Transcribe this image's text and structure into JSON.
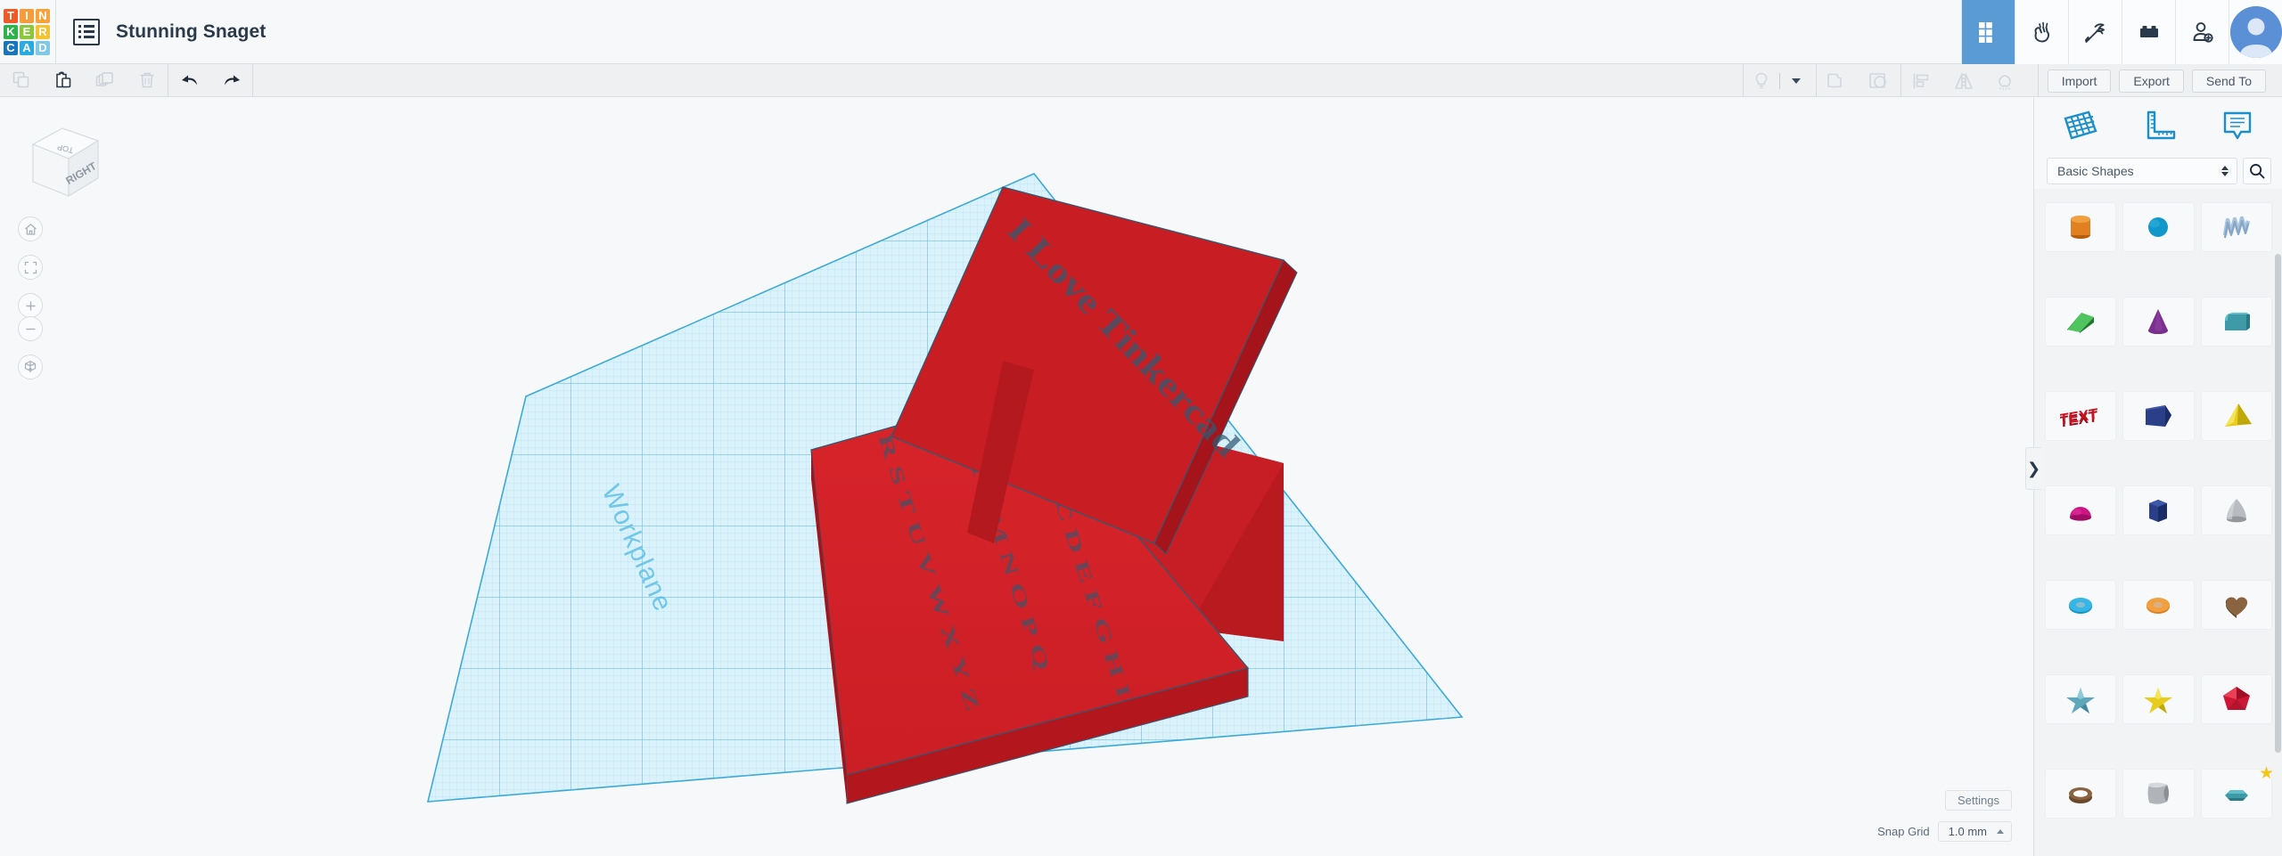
{
  "header": {
    "logo_text": [
      "T",
      "I",
      "N",
      "K",
      "E",
      "R",
      "C",
      "A",
      "D"
    ],
    "logo_colors": [
      "#f05a28",
      "#f79c3c",
      "#f7a23c",
      "#2eb24a",
      "#8cc63f",
      "#f2c230",
      "#1b75bb",
      "#29abe2",
      "#7fc8e8"
    ],
    "menu_icon": "list-menu-icon",
    "doc_title": "Stunning Snaget",
    "right_buttons": [
      {
        "name": "grid-view-icon",
        "label": "Grid",
        "active": true
      },
      {
        "name": "hand-tinker-icon",
        "label": "Tinker",
        "active": false
      },
      {
        "name": "pickaxe-icon",
        "label": "Blocks",
        "active": false
      },
      {
        "name": "lego-brick-icon",
        "label": "Bricks",
        "active": false
      },
      {
        "name": "add-person-icon",
        "label": "Invite",
        "active": false
      }
    ],
    "avatar": "user-avatar"
  },
  "toolbar": {
    "left_buttons": [
      {
        "name": "copy-icon",
        "label": "Copy",
        "disabled": true
      },
      {
        "name": "paste-icon",
        "label": "Paste",
        "disabled": false
      },
      {
        "name": "duplicate-icon",
        "label": "Duplicate",
        "disabled": true
      },
      {
        "name": "delete-icon",
        "label": "Delete",
        "disabled": true
      },
      {
        "name": "undo-icon",
        "label": "Undo",
        "disabled": false
      },
      {
        "name": "redo-icon",
        "label": "Redo",
        "disabled": false
      }
    ],
    "right_icons": [
      {
        "name": "lightbulb-icon",
        "label": "Light"
      },
      {
        "name": "group-icon",
        "label": "Group"
      },
      {
        "name": "ungroup-icon",
        "label": "Ungroup"
      },
      {
        "name": "align-icon",
        "label": "Align"
      },
      {
        "name": "mirror-icon",
        "label": "Mirror"
      },
      {
        "name": "magnet-icon",
        "label": "Workplane"
      }
    ],
    "import_label": "Import",
    "export_label": "Export",
    "sendto_label": "Send To"
  },
  "canvas": {
    "view_cube": {
      "top_face": "TOP",
      "right_face": "RIGHT"
    },
    "view_controls": [
      {
        "name": "home-view-button",
        "label": "Home view"
      },
      {
        "name": "fit-view-button",
        "label": "Fit all in view"
      },
      {
        "name": "zoom-in-button",
        "label": "Zoom in"
      },
      {
        "name": "zoom-out-button",
        "label": "Zoom out"
      },
      {
        "name": "perspective-toggle-button",
        "label": "Switch to orthographic view"
      }
    ],
    "workplane_label": "Workplane",
    "settings_label": "Settings",
    "snap_grid_label": "Snap Grid",
    "snap_grid_value": "1.0 mm",
    "model": {
      "color": "#d21f26",
      "plate_text": "I Love Tinkercad",
      "alphabet_col1": "ABCDEFGHI",
      "alphabet_col2": "JKLMNOPQ",
      "alphabet_col3": "RSTUVWXYZ"
    }
  },
  "right_panel": {
    "tabs": [
      {
        "name": "workplane-tab-icon",
        "label": "Workplane"
      },
      {
        "name": "ruler-tab-icon",
        "label": "Ruler"
      },
      {
        "name": "notes-tab-icon",
        "label": "Notes"
      }
    ],
    "collapse_handle": "❯",
    "shape_category": "Basic Shapes",
    "search_icon": "search-icon",
    "shapes": [
      {
        "name": "cylinder-shape",
        "label": "Box",
        "color": "#e08020",
        "dark": "#b65e10",
        "light": "#f0a040",
        "kind": "cylinder"
      },
      {
        "name": "sphere-shape",
        "label": "Sphere",
        "color": "#1197c9",
        "dark": "#0b7aa4",
        "light": "#35b6e4",
        "kind": "sphere"
      },
      {
        "name": "scribble-shape",
        "label": "Scribble",
        "color": "#a8c4dd",
        "dark": "#86a6c4",
        "light": "#c3d8ea",
        "kind": "scribble"
      },
      {
        "name": "wedge-shape",
        "label": "Wedge",
        "color": "#2f9e3f",
        "dark": "#1d7a2c",
        "light": "#4fc45f",
        "kind": "wedge"
      },
      {
        "name": "cone-shape",
        "label": "Cone",
        "color": "#7a2f8f",
        "dark": "#5e2070",
        "light": "#9a48ad",
        "kind": "cone"
      },
      {
        "name": "roof-shape",
        "label": "Roof",
        "color": "#3d9aa6",
        "dark": "#2a7a86",
        "light": "#5fc0cc",
        "kind": "roof"
      },
      {
        "name": "text-shape",
        "label": "Text",
        "color": "#cc1322",
        "dark": "#9e0c18",
        "light": "#e83a46",
        "kind": "text"
      },
      {
        "name": "box-shape",
        "label": "Box",
        "color": "#2a3f87",
        "dark": "#1c2c66",
        "light": "#3d57ab",
        "kind": "box"
      },
      {
        "name": "pyramid-shape",
        "label": "Pyramid",
        "color": "#e8cc1c",
        "dark": "#c0a80c",
        "light": "#f5e45a",
        "kind": "pyramid"
      },
      {
        "name": "hemisphere-shape",
        "label": "Half Sphere",
        "color": "#cc1484",
        "dark": "#9e0c64",
        "light": "#e83aa4",
        "kind": "hemisphere"
      },
      {
        "name": "hexprism-shape",
        "label": "Polygon",
        "color": "#2a3f87",
        "dark": "#1c2c66",
        "light": "#3d57ab",
        "kind": "hexprism"
      },
      {
        "name": "paraboloid-shape",
        "label": "Paraboloid",
        "color": "#b8bcc0",
        "dark": "#94989c",
        "light": "#dadee2",
        "kind": "paraboloid"
      },
      {
        "name": "torus-shape",
        "label": "Tube",
        "color": "#1197c9",
        "dark": "#0b7aa4",
        "light": "#35b6e4",
        "kind": "torus"
      },
      {
        "name": "round-roof-shape",
        "label": "Round Roof",
        "color": "#e08020",
        "dark": "#b65e10",
        "light": "#f0a040",
        "kind": "torus"
      },
      {
        "name": "heart-shape",
        "label": "Heart",
        "color": "#8a6440",
        "dark": "#6a4a2c",
        "light": "#a8825c",
        "kind": "heart"
      },
      {
        "name": "star-shape",
        "label": "Star",
        "color": "#5fa8bc",
        "dark": "#3f8a9c",
        "light": "#8ccadc",
        "kind": "star"
      },
      {
        "name": "star-gold-shape",
        "label": "Star",
        "color": "#e8cc1c",
        "dark": "#c0a80c",
        "light": "#f5e45a",
        "kind": "star"
      },
      {
        "name": "polyhedron-shape",
        "label": "Polygon",
        "color": "#cc1836",
        "dark": "#9e0f26",
        "light": "#e84056",
        "kind": "polyhedron"
      },
      {
        "name": "ring-shape",
        "label": "Tube",
        "color": "#8a6440",
        "dark": "#6a4a2c",
        "light": "#a8825c",
        "kind": "ring"
      },
      {
        "name": "rounded-cube-shape",
        "label": "Box",
        "color": "#b0b4b8",
        "dark": "#8c9094",
        "light": "#d6dade",
        "kind": "roundcube"
      },
      {
        "name": "gem-shape",
        "label": "Gem",
        "color": "#3d9aa6",
        "dark": "#2a7a86",
        "light": "#5fc0cc",
        "kind": "gem",
        "starred": true
      }
    ],
    "star_glyph": "★"
  }
}
